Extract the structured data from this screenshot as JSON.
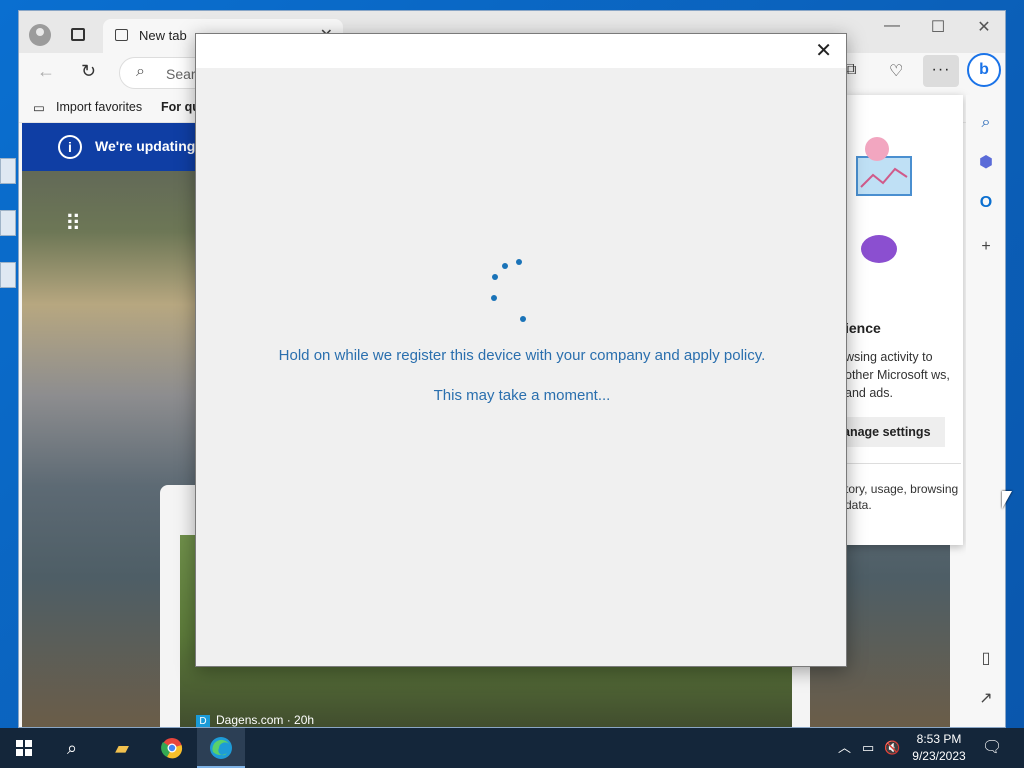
{
  "browser": {
    "tab_title": "New tab",
    "address_placeholder": "Sear",
    "favorites": [
      "Import favorites",
      "For qu"
    ],
    "banner_text": "We're updating",
    "ellipsis": "···",
    "bing_label": "b"
  },
  "background_card": {
    "source": "Dagens.com · 20h",
    "source_badge": "D"
  },
  "flyout": {
    "heading": "ience",
    "description": "wsing activity to other Microsoft ws, and ads.",
    "manage_button": "anage settings",
    "description2": "tory, usage, browsing data."
  },
  "dialog": {
    "message": "Hold on while we register this device with your company and apply policy.",
    "submessage": "This may take a moment..."
  },
  "taskbar": {
    "time": "8:53 PM",
    "date": "9/23/2023"
  },
  "icons": {
    "close": "✕",
    "minimize": "—",
    "maximize": "☐",
    "back": "←",
    "refresh": "↻",
    "search": "⌕",
    "add": "+",
    "apps": "⠿"
  },
  "colors": {
    "dialog_text": "#2a6fae",
    "spinner": "#1a73b8",
    "banner": "#0f3ea4",
    "desktop": "#0b6bc6"
  }
}
